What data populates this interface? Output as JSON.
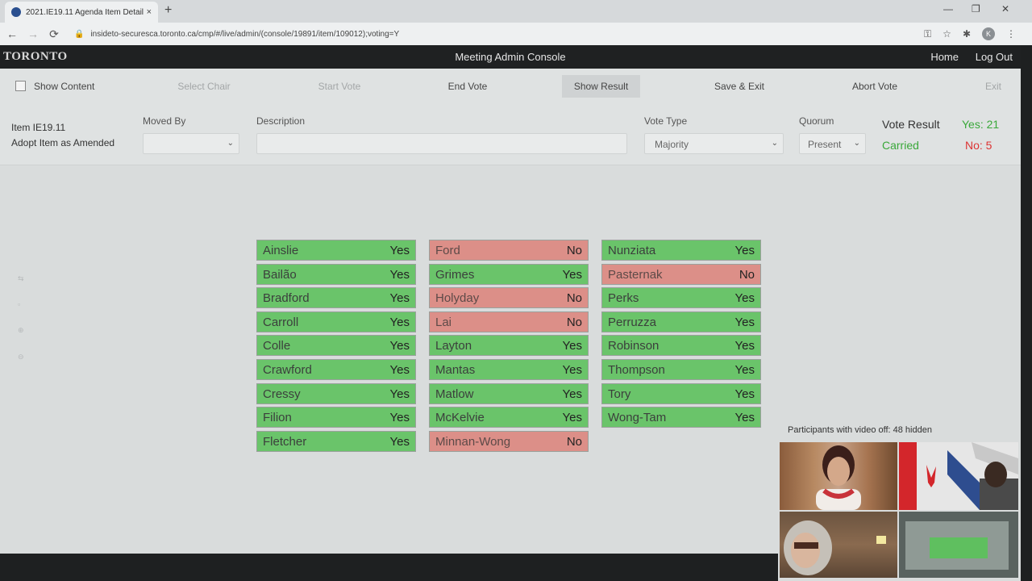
{
  "browser": {
    "tab_title": "2021.IE19.11 Agenda Item Detail",
    "tab_close": "×",
    "new_tab": "+",
    "url": "insideto-securesca.toronto.ca/cmp/#/live/admin/(console/19891/item/109012);voting=Y",
    "nav_back": "←",
    "nav_forward": "→",
    "nav_reload": "⟳",
    "lock": "🔒",
    "key_icon": "⚿",
    "star_icon": "☆",
    "ext_icon": "✱",
    "profile_initial": "K",
    "menu_icon": "⋮",
    "win_min": "—",
    "win_max": "❐",
    "win_close": "✕"
  },
  "app": {
    "logo": "TORONTO",
    "title": "Meeting Admin Console",
    "home": "Home",
    "logout": "Log Out"
  },
  "toolbar": {
    "show_content": "Show Content",
    "select_chair": "Select Chair",
    "start_vote": "Start Vote",
    "end_vote": "End Vote",
    "show_result": "Show Result",
    "save_exit": "Save & Exit",
    "abort_vote": "Abort Vote",
    "exit": "Exit"
  },
  "item": {
    "number": "Item IE19.11",
    "description": "Adopt Item as Amended"
  },
  "form": {
    "moved_by_label": "Moved By",
    "moved_by_value": "",
    "description_label": "Description",
    "vote_type_label": "Vote Type",
    "vote_type_value": "Majority",
    "quorum_label": "Quorum",
    "quorum_value": "Present",
    "chevron": "⌄"
  },
  "vote_result": {
    "label": "Vote Result",
    "outcome": "Carried",
    "yes": "Yes: 21",
    "no": "No: 5"
  },
  "votes": {
    "col1": [
      {
        "name": "Ainslie",
        "vote": "Yes"
      },
      {
        "name": "Bailão",
        "vote": "Yes"
      },
      {
        "name": "Bradford",
        "vote": "Yes"
      },
      {
        "name": "Carroll",
        "vote": "Yes"
      },
      {
        "name": "Colle",
        "vote": "Yes"
      },
      {
        "name": "Crawford",
        "vote": "Yes"
      },
      {
        "name": "Cressy",
        "vote": "Yes"
      },
      {
        "name": "Filion",
        "vote": "Yes"
      },
      {
        "name": "Fletcher",
        "vote": "Yes"
      }
    ],
    "col2": [
      {
        "name": "Ford",
        "vote": "No"
      },
      {
        "name": "Grimes",
        "vote": "Yes"
      },
      {
        "name": "Holyday",
        "vote": "No"
      },
      {
        "name": "Lai",
        "vote": "No"
      },
      {
        "name": "Layton",
        "vote": "Yes"
      },
      {
        "name": "Mantas",
        "vote": "Yes"
      },
      {
        "name": "Matlow",
        "vote": "Yes"
      },
      {
        "name": "McKelvie",
        "vote": "Yes"
      },
      {
        "name": "Minnan-Wong",
        "vote": "No"
      }
    ],
    "col3": [
      {
        "name": "Nunziata",
        "vote": "Yes"
      },
      {
        "name": "Pasternak",
        "vote": "No"
      },
      {
        "name": "Perks",
        "vote": "Yes"
      },
      {
        "name": "Perruzza",
        "vote": "Yes"
      },
      {
        "name": "Robinson",
        "vote": "Yes"
      },
      {
        "name": "Thompson",
        "vote": "Yes"
      },
      {
        "name": "Tory",
        "vote": "Yes"
      },
      {
        "name": "Wong-Tam",
        "vote": "Yes"
      }
    ]
  },
  "participants": {
    "label": "Participants with video off: 48 hidden"
  },
  "colors": {
    "yes_bg": "#6ac46a",
    "no_bg": "#dc8f88",
    "carried": "#3aa83a",
    "no_count": "#d33333",
    "header_bg": "#1f2122"
  }
}
